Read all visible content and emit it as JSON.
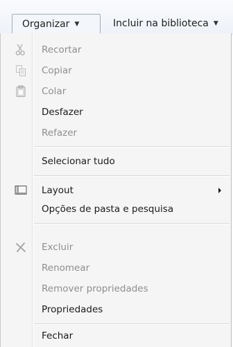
{
  "toolbar": {
    "organizar_label": "Organizar",
    "incluir_label": "Incluir na biblioteca"
  },
  "menu": {
    "items": [
      {
        "label": "Recortar",
        "icon": "scissors-icon",
        "enabled": false
      },
      {
        "label": "Copiar",
        "icon": "copy-icon",
        "enabled": false
      },
      {
        "label": "Colar",
        "icon": "clipboard-icon",
        "enabled": false
      },
      {
        "label": "Desfazer",
        "enabled": true
      },
      {
        "label": "Refazer",
        "enabled": false
      },
      {
        "label": "Selecionar tudo",
        "enabled": true
      },
      {
        "label": "Layout",
        "icon": "layout-icon",
        "enabled": true,
        "has_submenu": true
      },
      {
        "label": "Opções de pasta e pesquisa",
        "enabled": true
      },
      {
        "label": "Excluir",
        "icon": "delete-x-icon",
        "enabled": false
      },
      {
        "label": "Renomear",
        "enabled": false
      },
      {
        "label": "Remover propriedades",
        "enabled": false
      },
      {
        "label": "Propriedades",
        "enabled": true
      },
      {
        "label": "Fechar",
        "enabled": true
      }
    ]
  }
}
